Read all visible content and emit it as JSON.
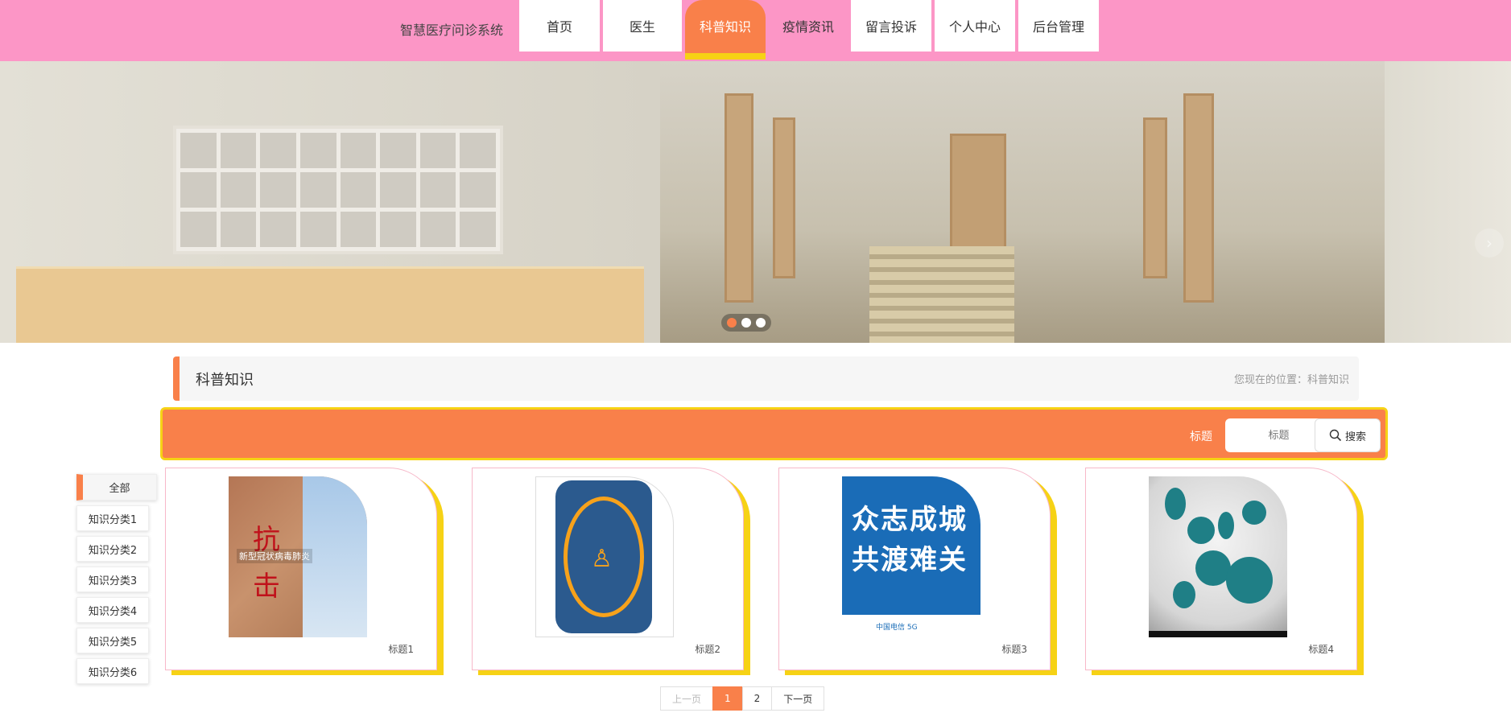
{
  "header": {
    "brand": "智慧医疗问诊系统",
    "nav": [
      {
        "label": "首页"
      },
      {
        "label": "医生"
      },
      {
        "label": "科普知识"
      },
      {
        "label": "疫情资讯"
      },
      {
        "label": "留言投诉"
      },
      {
        "label": "个人中心"
      },
      {
        "label": "后台管理"
      }
    ],
    "active_nav": "科普知识"
  },
  "banner": {
    "slide_count": 3,
    "active_slide": 1,
    "next_icon": "chevron-right-icon"
  },
  "section": {
    "title": "科普知识",
    "breadcrumb": "您现在的位置：科普知识"
  },
  "search": {
    "label": "标题",
    "input_placeholder": "标题",
    "button_label": "搜索",
    "button_icon": "search-icon"
  },
  "categories": [
    "全部",
    "知识分类1",
    "知识分类2",
    "知识分类3",
    "知识分类4",
    "知识分类5",
    "知识分类6"
  ],
  "cards": [
    {
      "title": "标题1",
      "image_text": [
        "抗",
        "击"
      ],
      "image_caption": "新型冠状病毒肺炎"
    },
    {
      "title": "标题2"
    },
    {
      "title": "标题3",
      "image_text": [
        "众志成城",
        "共渡难关"
      ],
      "image_caption": "中国电信 5G"
    },
    {
      "title": "标题4"
    }
  ],
  "pagination": {
    "prev_label": "上一页",
    "pages": [
      "1",
      "2"
    ],
    "current": "1",
    "next_label": "下一页"
  },
  "colors": {
    "header_bg": "#fc96c6",
    "accent": "#f9804a",
    "highlight": "#f6d215"
  }
}
